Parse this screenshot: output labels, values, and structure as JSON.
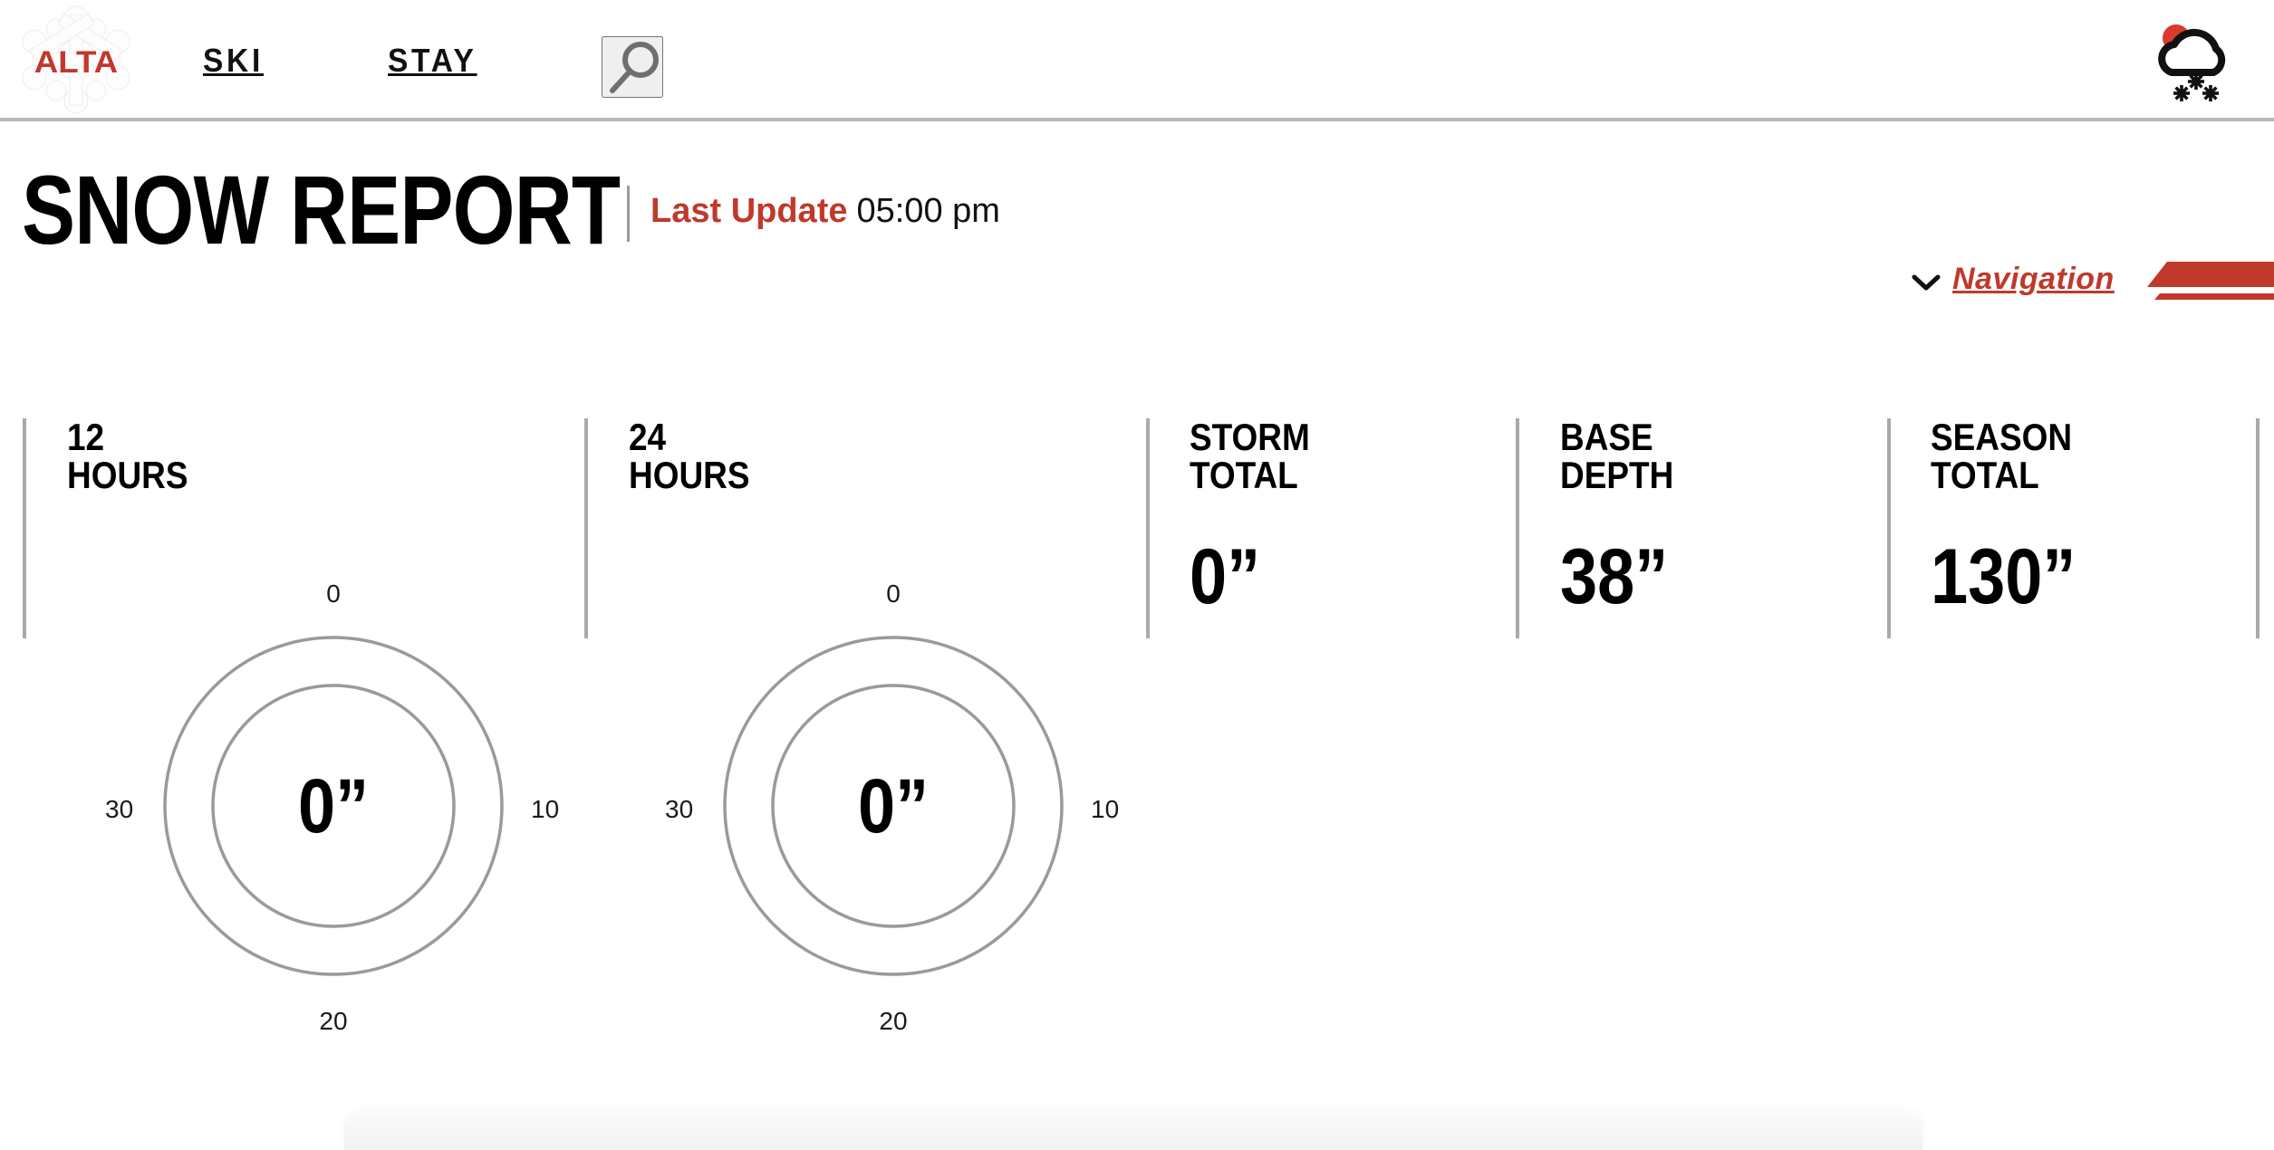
{
  "brand": {
    "logo_text": "ALTA",
    "logo_icon": "snowflake-icon"
  },
  "header": {
    "nav_items": [
      {
        "label": "SKI",
        "name": "nav-ski"
      },
      {
        "label": "STAY",
        "name": "nav-stay"
      }
    ],
    "search_icon": "search-icon",
    "weather_icon": "snow-cloud-icon"
  },
  "navrow": {
    "chevron_icon": "chevron-down-icon",
    "label": "Navigation"
  },
  "page": {
    "title": "SNOW REPORT",
    "last_update_label": "Last Update",
    "last_update_time": "05:00 pm"
  },
  "colors": {
    "brand_red": "#C0392B",
    "divider_gray": "#a8a8ae",
    "ring_gray": "#9a9a9a",
    "text_black": "#000000"
  },
  "gauges": [
    {
      "title": "12\nHOURS",
      "value": "0”",
      "ticks": {
        "top": "0",
        "right": "10",
        "bottom": "20",
        "left": "30"
      }
    },
    {
      "title": "24\nHOURS",
      "value": "0”",
      "ticks": {
        "top": "0",
        "right": "10",
        "bottom": "20",
        "left": "30"
      }
    }
  ],
  "stats": [
    {
      "title": "STORM\nTOTAL",
      "value": "0”"
    },
    {
      "title": "BASE\nDEPTH",
      "value": "38”"
    },
    {
      "title": "SEASON\nTOTAL",
      "value": "130”"
    }
  ],
  "chart_data": {
    "type": "gauge",
    "title": "Snow Report",
    "gauges": [
      {
        "name": "12 HOURS",
        "value": 0,
        "unit": "inches",
        "axis_ticks": [
          0,
          10,
          20,
          30
        ],
        "axis_tick_positions": [
          "top",
          "right",
          "bottom",
          "left"
        ],
        "range": [
          0,
          40
        ],
        "rings": 2
      },
      {
        "name": "24 HOURS",
        "value": 0,
        "unit": "inches",
        "axis_ticks": [
          0,
          10,
          20,
          30
        ],
        "axis_tick_positions": [
          "top",
          "right",
          "bottom",
          "left"
        ],
        "range": [
          0,
          40
        ],
        "rings": 2
      }
    ],
    "metrics": [
      {
        "name": "STORM TOTAL",
        "value": 0,
        "unit": "inches"
      },
      {
        "name": "BASE DEPTH",
        "value": 38,
        "unit": "inches"
      },
      {
        "name": "SEASON TOTAL",
        "value": 130,
        "unit": "inches"
      }
    ]
  }
}
